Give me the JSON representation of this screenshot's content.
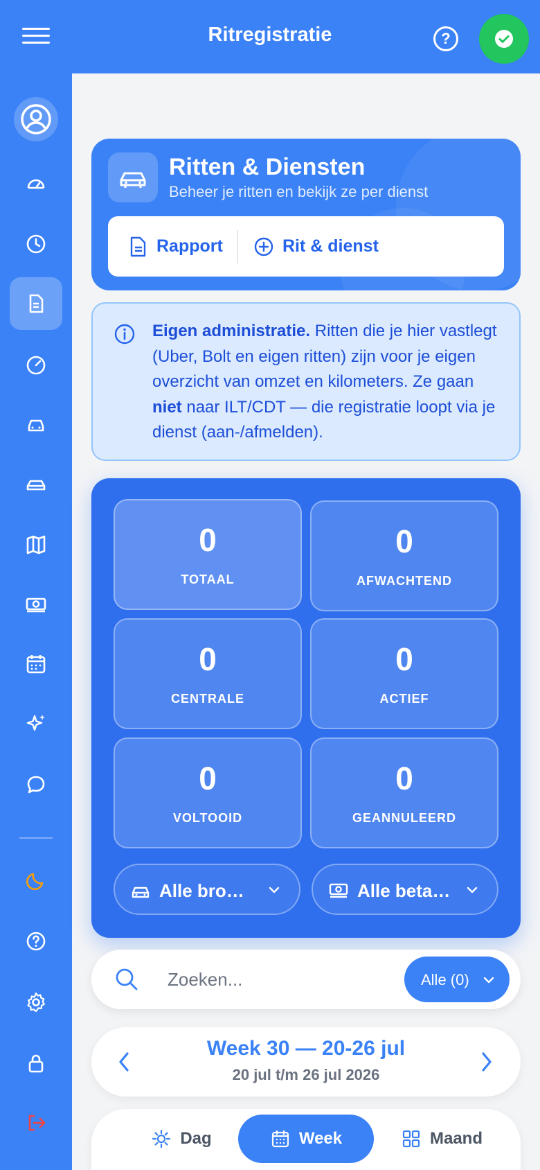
{
  "header": {
    "title": "Ritregistratie",
    "help_glyph": "?",
    "status_color": "#22c55e"
  },
  "sidebar": {
    "items": [
      {
        "icon": "dashboard-icon",
        "active": false
      },
      {
        "icon": "clock-icon",
        "active": false
      },
      {
        "icon": "document-icon",
        "active": true
      },
      {
        "icon": "speedometer-icon",
        "active": false
      },
      {
        "icon": "car-icon",
        "active": false
      },
      {
        "icon": "taxi-icon",
        "active": false
      },
      {
        "icon": "map-icon",
        "active": false
      },
      {
        "icon": "cash-icon",
        "active": false
      },
      {
        "icon": "calendar-icon",
        "active": false
      },
      {
        "icon": "sparkles-icon",
        "active": false
      },
      {
        "icon": "chat-icon",
        "active": false
      },
      {
        "icon": "moon-icon",
        "active": false
      },
      {
        "icon": "help-icon",
        "active": false
      },
      {
        "icon": "settings-icon",
        "active": false
      },
      {
        "icon": "lock-icon",
        "active": false
      },
      {
        "icon": "logout-icon",
        "active": false
      }
    ]
  },
  "hero": {
    "title": "Ritten & Diensten",
    "subtitle": "Beheer je ritten en bekijk ze per dienst",
    "report_label": "Rapport",
    "add_label": "Rit & dienst"
  },
  "info": {
    "bold_lead": "Eigen administratie.",
    "text_1": " Ritten die je hier vastlegt (Uber, Bolt en eigen ritten) zijn voor je eigen overzicht van omzet en kilometers. Ze gaan ",
    "bold_not": "niet",
    "text_2": " naar ILT/CDT — die registratie loopt via je dienst (aan-/afmelden)."
  },
  "stats": {
    "tiles": [
      {
        "value": "0",
        "label": "TOTAAL"
      },
      {
        "value": "0",
        "label": "AFWACHTEND"
      },
      {
        "value": "0",
        "label": "CENTRALE"
      },
      {
        "value": "0",
        "label": "ACTIEF"
      },
      {
        "value": "0",
        "label": "VOLTOOID"
      },
      {
        "value": "0",
        "label": "GEANNULEERD"
      }
    ],
    "source_filter": "Alle bro…",
    "payment_filter": "Alle beta…"
  },
  "search": {
    "placeholder": "Zoeken...",
    "filter_label": "Alle (0)"
  },
  "week": {
    "title": "Week 30 — 20-26 jul",
    "subtitle": "20 jul t/m 26 jul 2026"
  },
  "view_tabs": {
    "day": "Dag",
    "week": "Week",
    "month": "Maand",
    "active": "week"
  },
  "colors": {
    "primary": "#3b82f6",
    "accent_dark": "#2563eb",
    "moon": "#f59e0b",
    "logout": "#ef4444"
  }
}
